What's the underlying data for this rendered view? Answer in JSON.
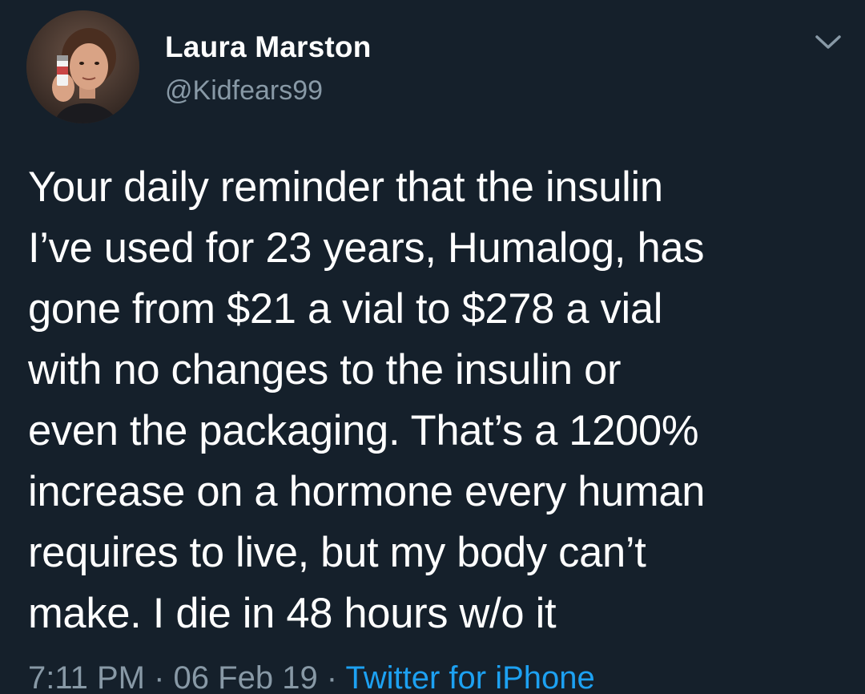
{
  "author": {
    "name": "Laura Marston",
    "handle": "@Kidfears99"
  },
  "tweet": {
    "lines": [
      "Your daily reminder that the insulin",
      "I’ve used for 23 years, Humalog, has",
      "gone from $21 a vial to $278 a vial",
      "with no changes to the insulin or",
      "even the packaging. That’s a 1200%",
      "increase on a hormone every human",
      "requires to live, but my body can’t",
      "make. I die in 48 hours w/o it"
    ],
    "time": "7:11 PM",
    "date": "06 Feb 19",
    "separator": " · ",
    "source": "Twitter for iPhone"
  },
  "icons": {
    "menu": "chevron-down-icon",
    "avatar": "profile-photo"
  },
  "colors": {
    "background": "#15202b",
    "text": "#ffffff",
    "secondary": "#8899a6",
    "link": "#1da1f2"
  }
}
